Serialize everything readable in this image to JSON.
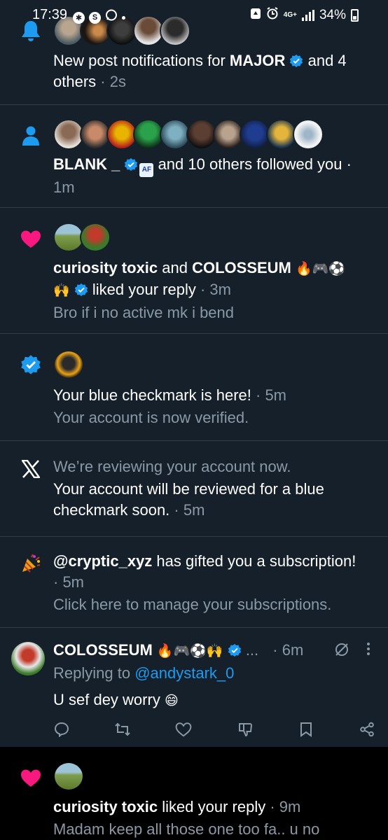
{
  "status_bar": {
    "time": "17:39",
    "icons": [
      "settings-icon",
      "s-app-icon",
      "chat-icon"
    ],
    "network": "4G+",
    "battery": "34%"
  },
  "notifications": [
    {
      "type": "new-post",
      "icon": "bell-icon",
      "lead": "New post notifications for ",
      "name": "MAJOR",
      "rest": " and 4 others",
      "time": "· 2s"
    },
    {
      "type": "follow",
      "icon": "person-icon",
      "name": "BLANK _ ",
      "badge": "AF",
      "rest": " and 10 others followed you ·",
      "time": "1m"
    },
    {
      "type": "like",
      "icon": "heart-icon",
      "name1": "curiosity toxic",
      "mid": " and ",
      "name2": "COLOSSEUM",
      "emoji1": "🔥🎮⚽",
      "emoji2": "🙌",
      "rest": " liked your reply",
      "time": " · 3m",
      "snippet": "Bro if i no active mk i bend"
    },
    {
      "type": "verified",
      "icon": "verified-icon",
      "title": "Your blue checkmark is here!",
      "time": " · 5m",
      "sub": "Your account is now verified."
    },
    {
      "type": "review",
      "icon": "x-logo-icon",
      "muted": "We’re reviewing your account now.",
      "text": "Your account will be reviewed for a blue checkmark soon.",
      "time": " · 5m"
    },
    {
      "type": "gift",
      "icon": "party-popper-icon",
      "handle": "@cryptic_xyz",
      "rest": " has gifted you a subscription!",
      "time": "· 5m",
      "sub": "Click here to manage your subscriptions."
    }
  ],
  "reply": {
    "name": "COLOSSEUM",
    "emoji": "🔥🎮⚽🙌",
    "ellipsis": "...",
    "time": "· 6m",
    "replying_prefix": "Replying to ",
    "replying_handle": "@andystark_0",
    "text": "U sef dey worry ",
    "text_emoji": "😄",
    "actions": [
      "reply-icon",
      "retweet-icon",
      "like-icon",
      "downvote-icon",
      "bookmark-icon",
      "share-icon"
    ]
  },
  "last": {
    "icon": "heart-icon",
    "name": "curiosity toxic",
    "rest": " liked your reply",
    "time": " · 9m",
    "snippet": "Madam keep all those one too fa.. u no"
  },
  "colors": {
    "background": "#15202b",
    "accent": "#1d9bf0",
    "like": "#f91880",
    "muted": "#8b98a5",
    "divider": "#2f3b47"
  }
}
